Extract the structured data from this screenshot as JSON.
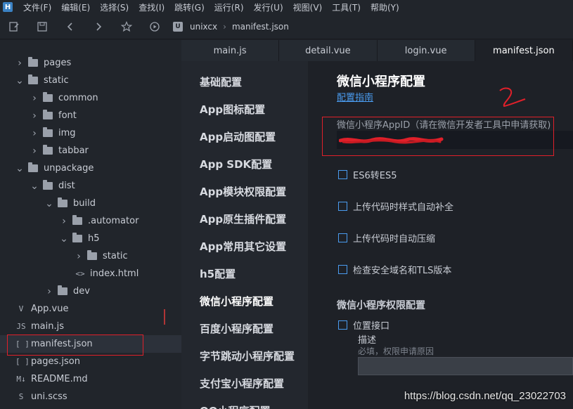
{
  "menubar": {
    "logo": "H",
    "items": [
      "文件(F)",
      "编辑(E)",
      "选择(S)",
      "查找(I)",
      "跳转(G)",
      "运行(R)",
      "发行(U)",
      "视图(V)",
      "工具(T)",
      "帮助(Y)"
    ]
  },
  "toolbar": {
    "breadcrumb_root": "unixcx",
    "breadcrumb_file": "manifest.json",
    "project_icon": "U"
  },
  "tree": [
    {
      "label": "pages",
      "kind": "folder",
      "expanded": false,
      "depth": 0
    },
    {
      "label": "static",
      "kind": "folder",
      "expanded": true,
      "depth": 0
    },
    {
      "label": "common",
      "kind": "folder",
      "expanded": false,
      "depth": 1
    },
    {
      "label": "font",
      "kind": "folder",
      "expanded": false,
      "depth": 1
    },
    {
      "label": "img",
      "kind": "folder",
      "expanded": false,
      "depth": 1
    },
    {
      "label": "tabbar",
      "kind": "folder",
      "expanded": false,
      "depth": 1
    },
    {
      "label": "unpackage",
      "kind": "folder",
      "expanded": true,
      "depth": 0
    },
    {
      "label": "dist",
      "kind": "folder",
      "expanded": true,
      "depth": 1
    },
    {
      "label": "build",
      "kind": "folder",
      "expanded": true,
      "depth": 2
    },
    {
      "label": ".automator",
      "kind": "folder",
      "expanded": false,
      "depth": 3
    },
    {
      "label": "h5",
      "kind": "folder",
      "expanded": true,
      "depth": 3
    },
    {
      "label": "static",
      "kind": "folder",
      "expanded": false,
      "depth": 4
    },
    {
      "label": "index.html",
      "kind": "file",
      "icon": "<>",
      "depth": 4
    },
    {
      "label": "dev",
      "kind": "folder",
      "expanded": false,
      "depth": 2
    },
    {
      "label": "App.vue",
      "kind": "file",
      "icon": "V",
      "depth": 0
    },
    {
      "label": "main.js",
      "kind": "file",
      "icon": "JS",
      "depth": 0
    },
    {
      "label": "manifest.json",
      "kind": "file",
      "icon": "[ ]",
      "depth": 0,
      "selected": true
    },
    {
      "label": "pages.json",
      "kind": "file",
      "icon": "[ ]",
      "depth": 0
    },
    {
      "label": "README.md",
      "kind": "file",
      "icon": "M↓",
      "depth": 0
    },
    {
      "label": "uni.scss",
      "kind": "file",
      "icon": "S",
      "depth": 0
    }
  ],
  "tabs": [
    {
      "label": "main.js",
      "active": false
    },
    {
      "label": "detail.vue",
      "active": false
    },
    {
      "label": "login.vue",
      "active": false
    },
    {
      "label": "manifest.json",
      "active": true
    }
  ],
  "confnav": [
    {
      "label": "基础配置",
      "active": false
    },
    {
      "label": "App图标配置",
      "active": false
    },
    {
      "label": "App启动图配置",
      "active": false
    },
    {
      "label": "App SDK配置",
      "active": false
    },
    {
      "label": "App模块权限配置",
      "active": false
    },
    {
      "label": "App原生插件配置",
      "active": false
    },
    {
      "label": "App常用其它设置",
      "active": false
    },
    {
      "label": "h5配置",
      "active": false
    },
    {
      "label": "微信小程序配置",
      "active": true
    },
    {
      "label": "百度小程序配置",
      "active": false
    },
    {
      "label": "字节跳动小程序配置",
      "active": false
    },
    {
      "label": "支付宝小程序配置",
      "active": false
    },
    {
      "label": "QQ小程序配置",
      "active": false
    }
  ],
  "content": {
    "title": "微信小程序配置",
    "guide_link": "配置指南",
    "appid_label": "微信小程序AppID（请在微信开发者工具中申请获取)",
    "appid_value": "",
    "options": [
      {
        "label": "ES6转ES5",
        "checked": false
      },
      {
        "label": "上传代码时样式自动补全",
        "checked": false
      },
      {
        "label": "上传代码时自动压缩",
        "checked": false
      },
      {
        "label": "检查安全域名和TLS版本",
        "checked": false
      }
    ],
    "permission_section": "微信小程序权限配置",
    "location_label": "位置接口",
    "desc_label": "描述",
    "desc_hint": "必填，权限申请原因"
  },
  "annotations": {
    "number_mark": "2"
  },
  "watermark": "https://blog.csdn.net/qq_23022703",
  "colors": {
    "accent": "#4a9cf0",
    "annotation_red": "#e0202a",
    "background": "#1e2127",
    "sidebar": "#21252b"
  }
}
